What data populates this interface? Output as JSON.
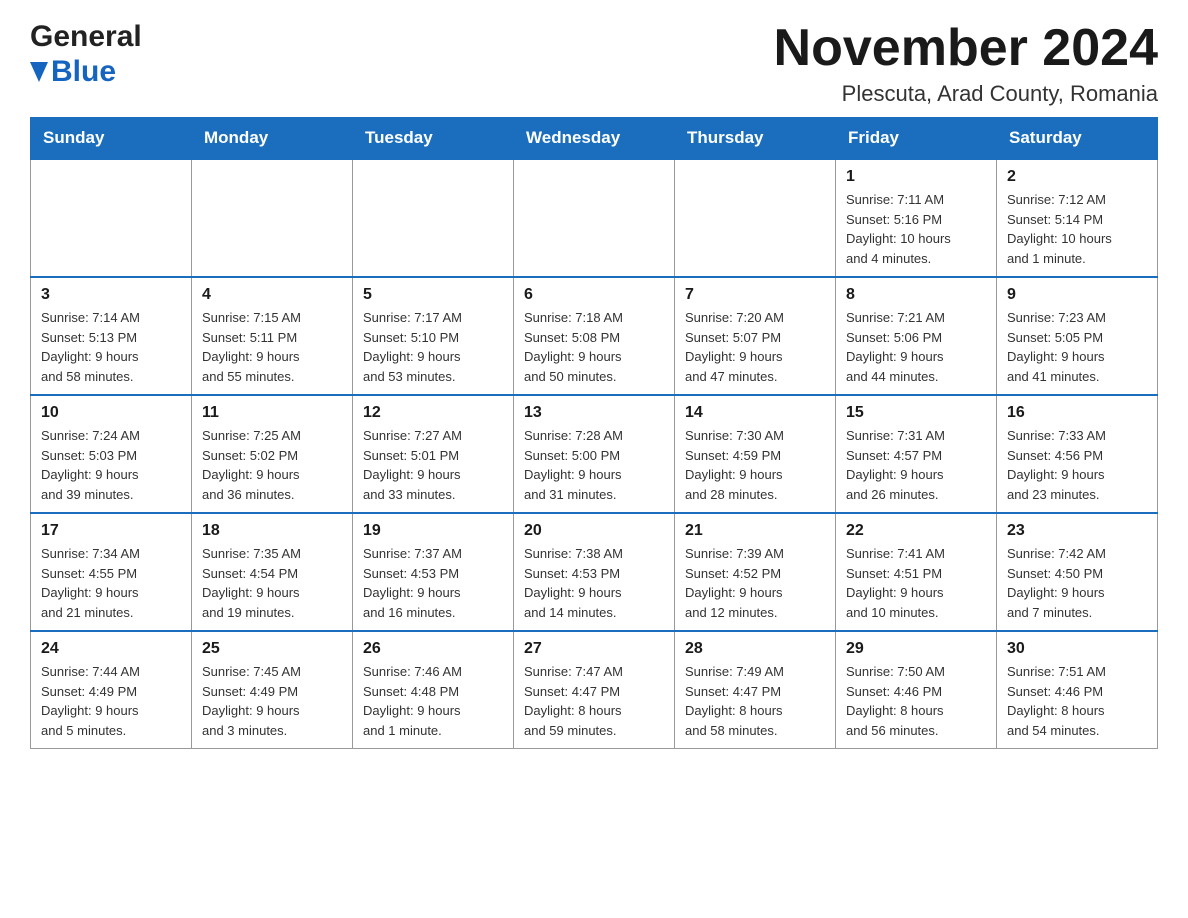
{
  "header": {
    "title": "November 2024",
    "location": "Plescuta, Arad County, Romania",
    "logo_general": "General",
    "logo_blue": "Blue"
  },
  "calendar": {
    "days_of_week": [
      "Sunday",
      "Monday",
      "Tuesday",
      "Wednesday",
      "Thursday",
      "Friday",
      "Saturday"
    ],
    "weeks": [
      [
        {
          "day": "",
          "info": ""
        },
        {
          "day": "",
          "info": ""
        },
        {
          "day": "",
          "info": ""
        },
        {
          "day": "",
          "info": ""
        },
        {
          "day": "",
          "info": ""
        },
        {
          "day": "1",
          "info": "Sunrise: 7:11 AM\nSunset: 5:16 PM\nDaylight: 10 hours\nand 4 minutes."
        },
        {
          "day": "2",
          "info": "Sunrise: 7:12 AM\nSunset: 5:14 PM\nDaylight: 10 hours\nand 1 minute."
        }
      ],
      [
        {
          "day": "3",
          "info": "Sunrise: 7:14 AM\nSunset: 5:13 PM\nDaylight: 9 hours\nand 58 minutes."
        },
        {
          "day": "4",
          "info": "Sunrise: 7:15 AM\nSunset: 5:11 PM\nDaylight: 9 hours\nand 55 minutes."
        },
        {
          "day": "5",
          "info": "Sunrise: 7:17 AM\nSunset: 5:10 PM\nDaylight: 9 hours\nand 53 minutes."
        },
        {
          "day": "6",
          "info": "Sunrise: 7:18 AM\nSunset: 5:08 PM\nDaylight: 9 hours\nand 50 minutes."
        },
        {
          "day": "7",
          "info": "Sunrise: 7:20 AM\nSunset: 5:07 PM\nDaylight: 9 hours\nand 47 minutes."
        },
        {
          "day": "8",
          "info": "Sunrise: 7:21 AM\nSunset: 5:06 PM\nDaylight: 9 hours\nand 44 minutes."
        },
        {
          "day": "9",
          "info": "Sunrise: 7:23 AM\nSunset: 5:05 PM\nDaylight: 9 hours\nand 41 minutes."
        }
      ],
      [
        {
          "day": "10",
          "info": "Sunrise: 7:24 AM\nSunset: 5:03 PM\nDaylight: 9 hours\nand 39 minutes."
        },
        {
          "day": "11",
          "info": "Sunrise: 7:25 AM\nSunset: 5:02 PM\nDaylight: 9 hours\nand 36 minutes."
        },
        {
          "day": "12",
          "info": "Sunrise: 7:27 AM\nSunset: 5:01 PM\nDaylight: 9 hours\nand 33 minutes."
        },
        {
          "day": "13",
          "info": "Sunrise: 7:28 AM\nSunset: 5:00 PM\nDaylight: 9 hours\nand 31 minutes."
        },
        {
          "day": "14",
          "info": "Sunrise: 7:30 AM\nSunset: 4:59 PM\nDaylight: 9 hours\nand 28 minutes."
        },
        {
          "day": "15",
          "info": "Sunrise: 7:31 AM\nSunset: 4:57 PM\nDaylight: 9 hours\nand 26 minutes."
        },
        {
          "day": "16",
          "info": "Sunrise: 7:33 AM\nSunset: 4:56 PM\nDaylight: 9 hours\nand 23 minutes."
        }
      ],
      [
        {
          "day": "17",
          "info": "Sunrise: 7:34 AM\nSunset: 4:55 PM\nDaylight: 9 hours\nand 21 minutes."
        },
        {
          "day": "18",
          "info": "Sunrise: 7:35 AM\nSunset: 4:54 PM\nDaylight: 9 hours\nand 19 minutes."
        },
        {
          "day": "19",
          "info": "Sunrise: 7:37 AM\nSunset: 4:53 PM\nDaylight: 9 hours\nand 16 minutes."
        },
        {
          "day": "20",
          "info": "Sunrise: 7:38 AM\nSunset: 4:53 PM\nDaylight: 9 hours\nand 14 minutes."
        },
        {
          "day": "21",
          "info": "Sunrise: 7:39 AM\nSunset: 4:52 PM\nDaylight: 9 hours\nand 12 minutes."
        },
        {
          "day": "22",
          "info": "Sunrise: 7:41 AM\nSunset: 4:51 PM\nDaylight: 9 hours\nand 10 minutes."
        },
        {
          "day": "23",
          "info": "Sunrise: 7:42 AM\nSunset: 4:50 PM\nDaylight: 9 hours\nand 7 minutes."
        }
      ],
      [
        {
          "day": "24",
          "info": "Sunrise: 7:44 AM\nSunset: 4:49 PM\nDaylight: 9 hours\nand 5 minutes."
        },
        {
          "day": "25",
          "info": "Sunrise: 7:45 AM\nSunset: 4:49 PM\nDaylight: 9 hours\nand 3 minutes."
        },
        {
          "day": "26",
          "info": "Sunrise: 7:46 AM\nSunset: 4:48 PM\nDaylight: 9 hours\nand 1 minute."
        },
        {
          "day": "27",
          "info": "Sunrise: 7:47 AM\nSunset: 4:47 PM\nDaylight: 8 hours\nand 59 minutes."
        },
        {
          "day": "28",
          "info": "Sunrise: 7:49 AM\nSunset: 4:47 PM\nDaylight: 8 hours\nand 58 minutes."
        },
        {
          "day": "29",
          "info": "Sunrise: 7:50 AM\nSunset: 4:46 PM\nDaylight: 8 hours\nand 56 minutes."
        },
        {
          "day": "30",
          "info": "Sunrise: 7:51 AM\nSunset: 4:46 PM\nDaylight: 8 hours\nand 54 minutes."
        }
      ]
    ]
  }
}
